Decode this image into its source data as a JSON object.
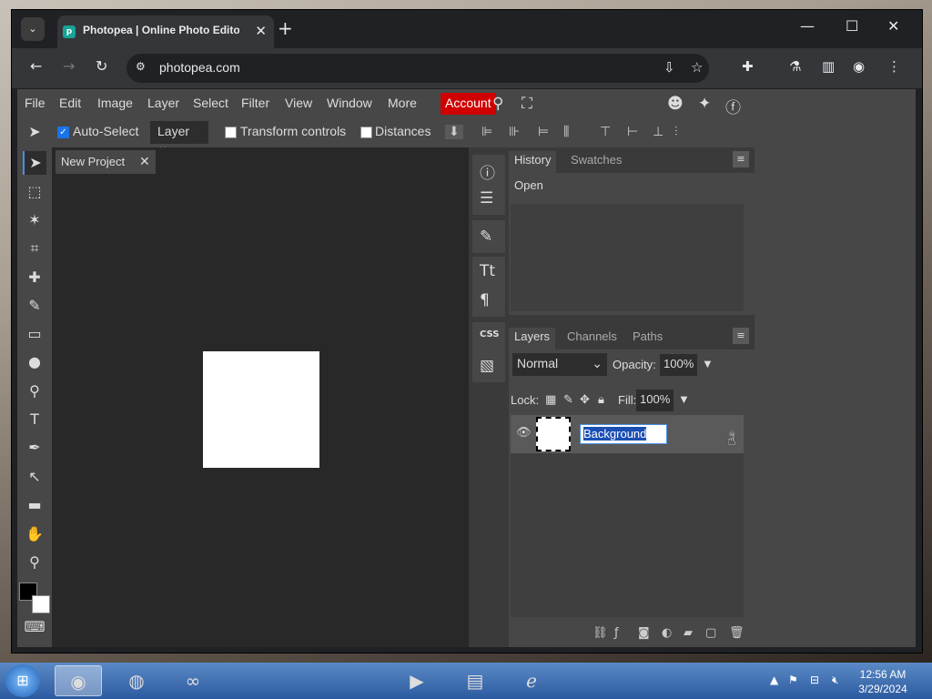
{
  "browser": {
    "tab_title": "Photopea | Online Photo Editor",
    "url": "photopea.com"
  },
  "menu": {
    "items": [
      "File",
      "Edit",
      "Image",
      "Layer",
      "Select",
      "Filter",
      "View",
      "Window",
      "More"
    ],
    "account": "Account"
  },
  "options": {
    "auto_select": "Auto-Select",
    "layer_select": "Layer",
    "transform_controls": "Transform controls",
    "distances": "Distances"
  },
  "document": {
    "tab_name": "New Project"
  },
  "history": {
    "tabs": [
      "History",
      "Swatches"
    ],
    "items": [
      "Open"
    ]
  },
  "layers": {
    "tabs": [
      "Layers",
      "Channels",
      "Paths"
    ],
    "blend_mode": "Normal",
    "opacity_label": "Opacity:",
    "opacity": "100%",
    "lock_label": "Lock:",
    "fill_label": "Fill:",
    "fill": "100%",
    "layer_name": "Background"
  },
  "side_strip": {
    "css_label": "CSS"
  },
  "taskbar": {
    "time": "12:56 AM",
    "date": "3/29/2024"
  },
  "colors": {
    "accent": "#d00000",
    "selection": "#1a4fb5"
  }
}
